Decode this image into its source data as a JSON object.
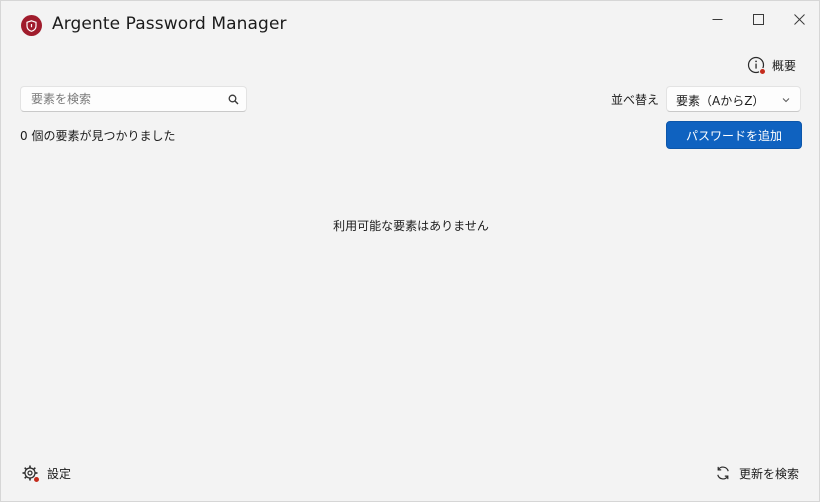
{
  "window": {
    "title": "Argente Password Manager"
  },
  "header": {
    "about_label": "概要"
  },
  "search": {
    "placeholder": "要素を検索",
    "value": ""
  },
  "sort": {
    "label": "並べ替え",
    "selected": "要素（AからZ）"
  },
  "list": {
    "count_text": "0 個の要素が見つかりました",
    "empty_text": "利用可能な要素はありません"
  },
  "actions": {
    "add_password_label": "パスワードを追加"
  },
  "footer": {
    "settings_label": "設定",
    "check_updates_label": "更新を検索"
  },
  "colors": {
    "accent": "#0f62c0",
    "logo": "#a01c2c",
    "notification_dot": "#c42b1c"
  }
}
